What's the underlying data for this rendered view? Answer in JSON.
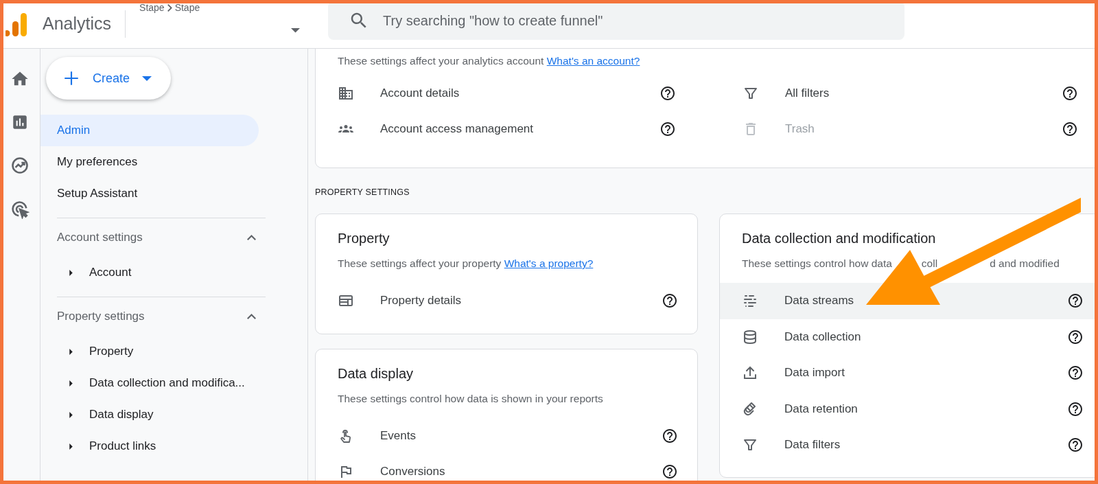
{
  "app": {
    "name": "Analytics",
    "breadcrumb": [
      "Stape",
      "Stape"
    ]
  },
  "search": {
    "placeholder": "Try searching \"how to create funnel\""
  },
  "create_button": {
    "label": "Create"
  },
  "nav": {
    "items": [
      {
        "label": "Admin",
        "selected": true
      },
      {
        "label": "My preferences",
        "selected": false
      },
      {
        "label": "Setup Assistant",
        "selected": false
      }
    ],
    "sections": [
      {
        "title": "Account settings",
        "expanded": true,
        "items": [
          {
            "label": "Account",
            "expanded": false
          }
        ]
      },
      {
        "title": "Property settings",
        "expanded": true,
        "items": [
          {
            "label": "Property",
            "expanded": false
          },
          {
            "label": "Data collection and modifica...",
            "expanded": false
          },
          {
            "label": "Data display",
            "expanded": false
          },
          {
            "label": "Product links",
            "expanded": false
          }
        ]
      }
    ]
  },
  "account_card": {
    "subtitle": "These settings affect your analytics account",
    "link": "What's an account?",
    "rows": [
      {
        "label": "Account details",
        "disabled": false
      },
      {
        "label": "All filters",
        "disabled": false
      },
      {
        "label": "Account access management",
        "disabled": false
      },
      {
        "label": "Trash",
        "disabled": true
      }
    ]
  },
  "property_section": {
    "label": "PROPERTY SETTINGS",
    "cards": [
      {
        "title": "Property",
        "subtitle": "These settings affect your property",
        "link": "What's a property?",
        "rows": [
          {
            "label": "Property details",
            "highlighted": false
          }
        ]
      },
      {
        "title": "Data display",
        "subtitle": "These settings control how data is shown in your reports",
        "rows": [
          {
            "label": "Events",
            "highlighted": false
          },
          {
            "label": "Conversions",
            "highlighted": false
          }
        ]
      },
      {
        "title": "Data collection and modification",
        "subtitle": [
          "These settings control how data",
          "coll",
          "d and modified"
        ],
        "rows": [
          {
            "label": "Data streams",
            "highlighted": true
          },
          {
            "label": "Data collection",
            "highlighted": false
          },
          {
            "label": "Data import",
            "highlighted": false
          },
          {
            "label": "Data retention",
            "highlighted": false
          },
          {
            "label": "Data filters",
            "highlighted": false
          }
        ]
      }
    ]
  }
}
